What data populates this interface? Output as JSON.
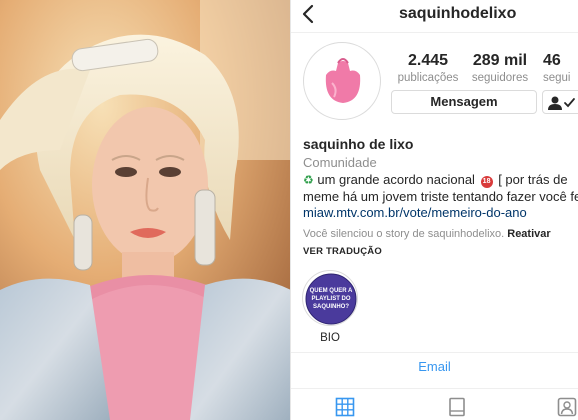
{
  "profile": {
    "username": "saquinhodelixo",
    "display_name": "saquinho de lixo",
    "category": "Comunidade",
    "bio_line_1": "um grande acordo nacional",
    "bio_line_1_tail": "[ por trás de",
    "bio_line_2": "meme há um jovem triste tentando fazer você fe",
    "link": "miaw.mtv.com.br/vote/memeiro-do-ano",
    "noentry_text": "18"
  },
  "stats": {
    "posts_value": "2.445",
    "posts_label": "publicações",
    "followers_value": "289 mil",
    "followers_label": "seguidores",
    "following_value": "46",
    "following_label": "segui"
  },
  "actions": {
    "message_label": "Mensagem"
  },
  "notices": {
    "silenced_text": "Você silenciou o story de saquinhodelixo.",
    "reactivate_label": "Reativar",
    "see_translation_label": "VER TRADUÇÃO"
  },
  "highlight": {
    "label": "BIO",
    "cover_text_1": "QUEM QUER A",
    "cover_text_2": "PLAYLIST DO",
    "cover_text_3": "SAQUINHO?"
  },
  "contact": {
    "email_label": "Email"
  },
  "colors": {
    "link_blue": "#003569",
    "action_blue": "#3897f0",
    "muted_gray": "#8e8e8e",
    "avatar_pink": "#f07aa8",
    "highlight_purple": "#4a3a9c"
  },
  "icons": {
    "back": "chevron-left-icon",
    "follow_status": "person-check-icon",
    "recycle": "recycle-icon",
    "no_entry": "no-entry-icon",
    "grid_tab": "grid-icon",
    "feed_tab": "feed-icon",
    "tagged_tab": "tagged-person-icon"
  }
}
